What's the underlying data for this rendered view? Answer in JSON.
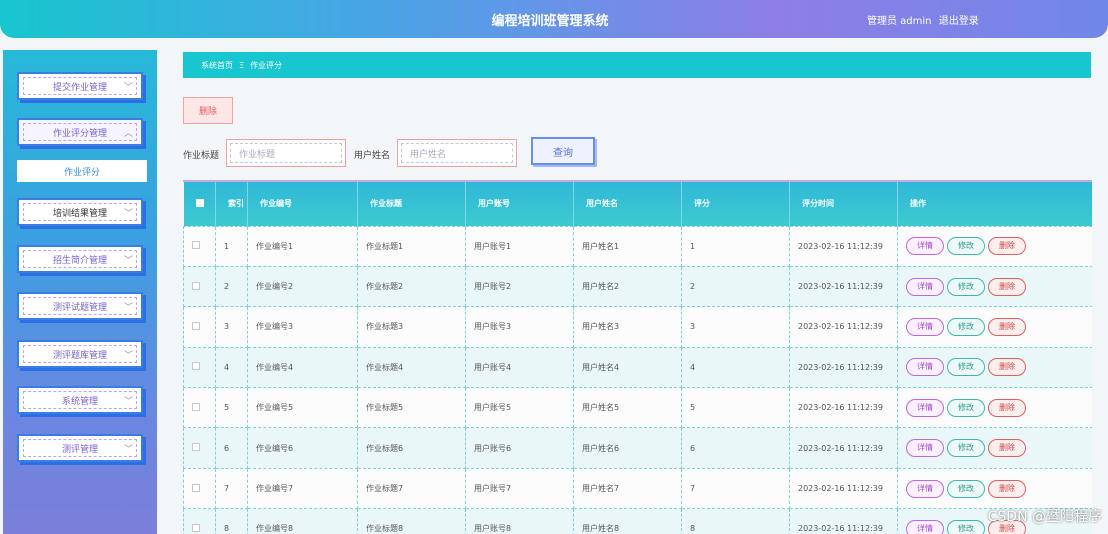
{
  "header": {
    "title": "编程培训班管理系统",
    "user": "管理员 admin",
    "logout": "退出登录"
  },
  "sidebar": {
    "items": [
      {
        "label": "提交作业管理"
      },
      {
        "label": "作业评分管理"
      },
      {
        "label": "培训结果管理"
      },
      {
        "label": "招生简介管理"
      },
      {
        "label": "测评试题管理"
      },
      {
        "label": "测评题库管理"
      },
      {
        "label": "系统管理"
      },
      {
        "label": "测评管理"
      }
    ],
    "submenu": "作业评分"
  },
  "breadcrumb": {
    "home": "系统首页",
    "sep": "Ξ",
    "current": "作业评分"
  },
  "toolbar": {
    "delete_label": "删除"
  },
  "search": {
    "title_label": "作业标题",
    "title_placeholder": "作业标题",
    "name_label": "用户姓名",
    "name_placeholder": "用户姓名",
    "query_label": "查询"
  },
  "table": {
    "headers": [
      "索引",
      "作业编号",
      "作业标题",
      "用户账号",
      "用户姓名",
      "评分",
      "评分时间",
      "操作"
    ],
    "actions": {
      "detail": "详情",
      "edit": "修改",
      "delete": "删除"
    },
    "rows": [
      {
        "idx": "1",
        "no": "作业编号1",
        "title": "作业标题1",
        "account": "用户账号1",
        "name": "用户姓名1",
        "score": "1",
        "time": "2023-02-16 11:12:39"
      },
      {
        "idx": "2",
        "no": "作业编号2",
        "title": "作业标题2",
        "account": "用户账号2",
        "name": "用户姓名2",
        "score": "2",
        "time": "2023-02-16 11:12:39"
      },
      {
        "idx": "3",
        "no": "作业编号3",
        "title": "作业标题3",
        "account": "用户账号3",
        "name": "用户姓名3",
        "score": "3",
        "time": "2023-02-16 11:12:39"
      },
      {
        "idx": "4",
        "no": "作业编号4",
        "title": "作业标题4",
        "account": "用户账号4",
        "name": "用户姓名4",
        "score": "4",
        "time": "2023-02-16 11:12:39"
      },
      {
        "idx": "5",
        "no": "作业编号5",
        "title": "作业标题5",
        "account": "用户账号5",
        "name": "用户姓名5",
        "score": "5",
        "time": "2023-02-16 11:12:39"
      },
      {
        "idx": "6",
        "no": "作业编号6",
        "title": "作业标题6",
        "account": "用户账号6",
        "name": "用户姓名6",
        "score": "6",
        "time": "2023-02-16 11:12:39"
      },
      {
        "idx": "7",
        "no": "作业编号7",
        "title": "作业标题7",
        "account": "用户账号7",
        "name": "用户姓名7",
        "score": "7",
        "time": "2023-02-16 11:12:39"
      },
      {
        "idx": "8",
        "no": "作业编号8",
        "title": "作业标题8",
        "account": "用户账号8",
        "name": "用户姓名8",
        "score": "8",
        "time": "2023-02-16 11:12:39"
      }
    ]
  },
  "watermark": "CSDN @暨阳程序"
}
